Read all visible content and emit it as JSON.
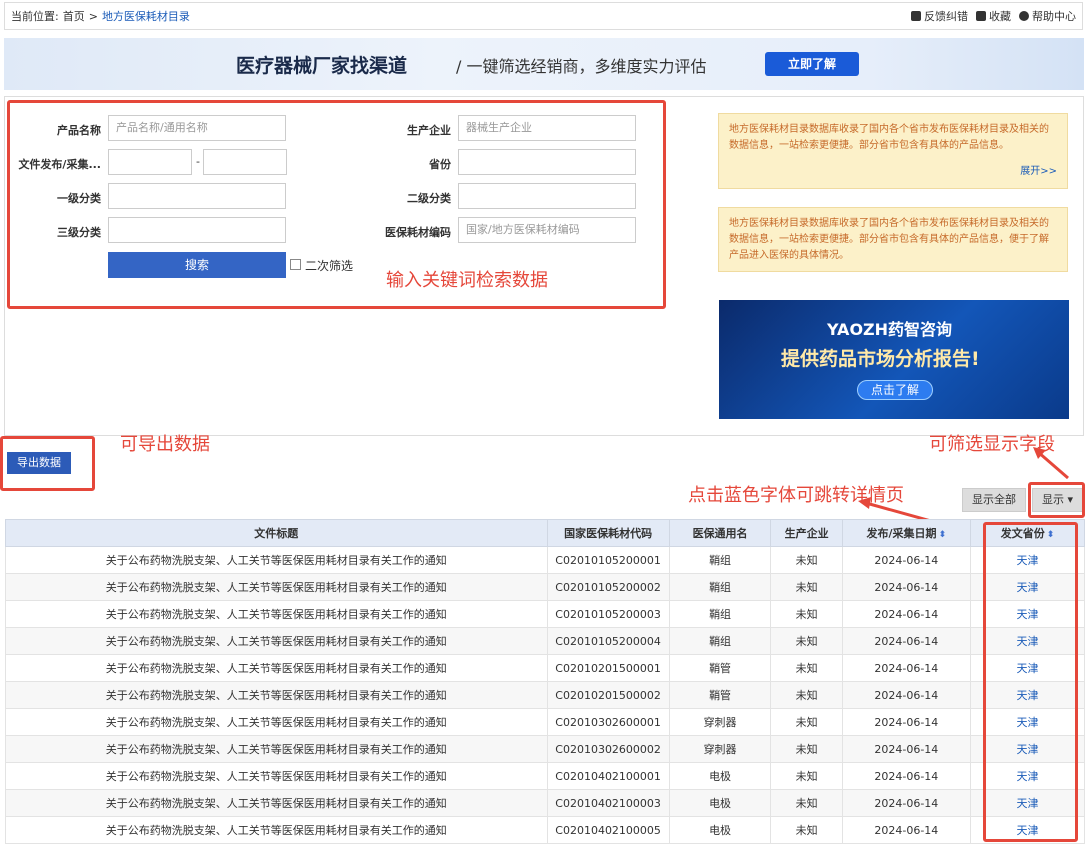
{
  "breadcrumb": {
    "prefix": "当前位置:",
    "home": "首页",
    "sep": ">",
    "current": "地方医保耗材目录"
  },
  "toplinks": {
    "feedback": "反馈纠错",
    "favorite": "收藏",
    "help": "帮助中心"
  },
  "banner": {
    "title": "医疗器械厂家找渠道",
    "subtitle": "/ 一键筛选经销商，多维度实力评估",
    "button": "立即了解"
  },
  "form": {
    "product_name_label": "产品名称",
    "product_name_placeholder": "产品名称/通用名称",
    "manufacturer_label": "生产企业",
    "manufacturer_placeholder": "器械生产企业",
    "date_label": "文件发布/采集...",
    "date_sep": "-",
    "province_label": "省份",
    "cat1_label": "一级分类",
    "cat2_label": "二级分类",
    "cat3_label": "三级分类",
    "code_label": "医保耗材编码",
    "code_placeholder": "国家/地方医保耗材编码",
    "search_button": "搜索",
    "secondary_filter": "二次筛选"
  },
  "annotations": {
    "search": "输入关键词检索数据",
    "export": "可导出数据",
    "fields": "可筛选显示字段",
    "detail": "点击蓝色字体可跳转详情页"
  },
  "notes": {
    "note1": "地方医保耗材目录数据库收录了国内各个省市发布医保耗材目录及相关的数据信息，一站检索更便捷。部分省市包含有具体的产品信息。",
    "note1_more": "展开>>",
    "note2": "地方医保耗材目录数据库收录了国内各个省市发布医保耗材目录及相关的数据信息，一站检索更便捷。部分省市包含有具体的产品信息，便于了解产品进入医保的具体情况。"
  },
  "ad": {
    "logo": "YAOZH药智咨询",
    "headline": "提供药品市场分析报告!",
    "button": "点击了解"
  },
  "toolbar": {
    "export": "导出数据",
    "show_all": "显示全部",
    "show": "显示 ▾"
  },
  "table": {
    "headers": [
      "文件标题",
      "国家医保耗材代码",
      "医保通用名",
      "生产企业",
      "发布/采集日期",
      "发文省份"
    ],
    "rows": [
      [
        "关于公布药物洗脱支架、人工关节等医保医用耗材目录有关工作的通知",
        "C02010105200001",
        "鞘组",
        "未知",
        "2024-06-14",
        "天津"
      ],
      [
        "关于公布药物洗脱支架、人工关节等医保医用耗材目录有关工作的通知",
        "C02010105200002",
        "鞘组",
        "未知",
        "2024-06-14",
        "天津"
      ],
      [
        "关于公布药物洗脱支架、人工关节等医保医用耗材目录有关工作的通知",
        "C02010105200003",
        "鞘组",
        "未知",
        "2024-06-14",
        "天津"
      ],
      [
        "关于公布药物洗脱支架、人工关节等医保医用耗材目录有关工作的通知",
        "C02010105200004",
        "鞘组",
        "未知",
        "2024-06-14",
        "天津"
      ],
      [
        "关于公布药物洗脱支架、人工关节等医保医用耗材目录有关工作的通知",
        "C02010201500001",
        "鞘管",
        "未知",
        "2024-06-14",
        "天津"
      ],
      [
        "关于公布药物洗脱支架、人工关节等医保医用耗材目录有关工作的通知",
        "C02010201500002",
        "鞘管",
        "未知",
        "2024-06-14",
        "天津"
      ],
      [
        "关于公布药物洗脱支架、人工关节等医保医用耗材目录有关工作的通知",
        "C02010302600001",
        "穿刺器",
        "未知",
        "2024-06-14",
        "天津"
      ],
      [
        "关于公布药物洗脱支架、人工关节等医保医用耗材目录有关工作的通知",
        "C02010302600002",
        "穿刺器",
        "未知",
        "2024-06-14",
        "天津"
      ],
      [
        "关于公布药物洗脱支架、人工关节等医保医用耗材目录有关工作的通知",
        "C02010402100001",
        "电极",
        "未知",
        "2024-06-14",
        "天津"
      ],
      [
        "关于公布药物洗脱支架、人工关节等医保医用耗材目录有关工作的通知",
        "C02010402100003",
        "电极",
        "未知",
        "2024-06-14",
        "天津"
      ],
      [
        "关于公布药物洗脱支架、人工关节等医保医用耗材目录有关工作的通知",
        "C02010402100005",
        "电极",
        "未知",
        "2024-06-14",
        "天津"
      ]
    ]
  }
}
